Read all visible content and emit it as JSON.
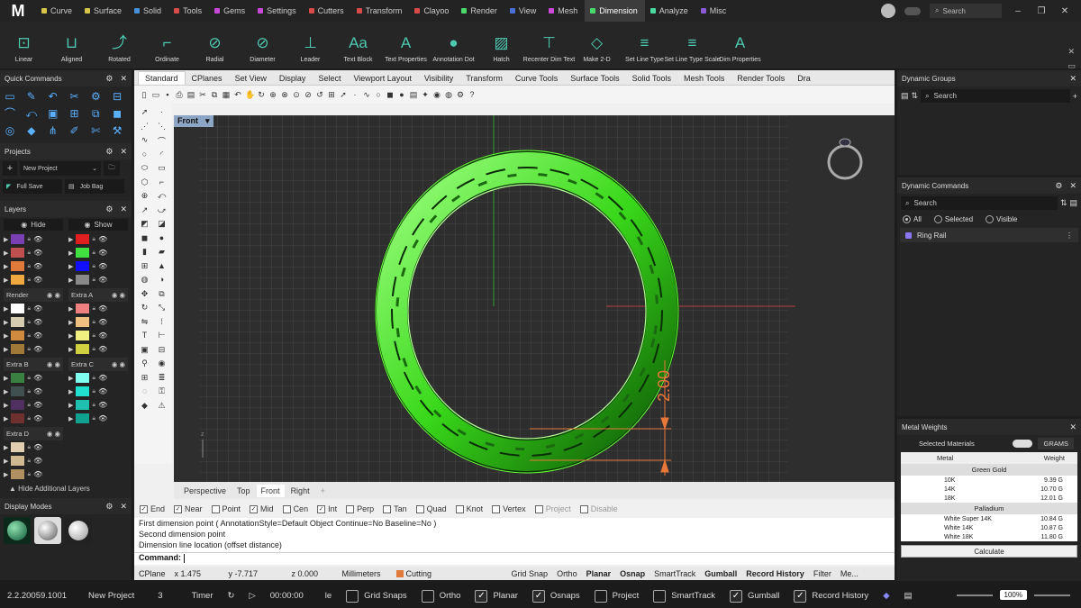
{
  "menubar": {
    "logo": "M",
    "tabs": [
      {
        "label": "Curve",
        "color": "#d9c44a"
      },
      {
        "label": "Surface",
        "color": "#d9c44a"
      },
      {
        "label": "Solid",
        "color": "#4a8fd9"
      },
      {
        "label": "Tools",
        "color": "#d94a4a"
      },
      {
        "label": "Gems",
        "color": "#c94ad9"
      },
      {
        "label": "Settings",
        "color": "#c94ad9"
      },
      {
        "label": "Cutters",
        "color": "#d94a4a"
      },
      {
        "label": "Transform",
        "color": "#d94a4a"
      },
      {
        "label": "Clayoo",
        "color": "#d94a4a"
      },
      {
        "label": "Render",
        "color": "#4ad96b"
      },
      {
        "label": "View",
        "color": "#4a6fd9"
      },
      {
        "label": "Mesh",
        "color": "#c94ad9"
      },
      {
        "label": "Dimension",
        "color": "#4ad96b"
      },
      {
        "label": "Analyze",
        "color": "#4ad9a0"
      },
      {
        "label": "Misc",
        "color": "#8a5ad9"
      }
    ],
    "active_tab": "Dimension",
    "search_placeholder": "Search"
  },
  "toolbar": {
    "tools": [
      {
        "label": "Linear",
        "icon": "⊡"
      },
      {
        "label": "Aligned",
        "icon": "⊔"
      },
      {
        "label": "Rotated",
        "icon": "⤴"
      },
      {
        "label": "Ordinate",
        "icon": "⌐"
      },
      {
        "label": "Radial",
        "icon": "⊘"
      },
      {
        "label": "Diameter",
        "icon": "⊘"
      },
      {
        "label": "Leader",
        "icon": "⊥"
      },
      {
        "label": "Text Block",
        "icon": "Aa"
      },
      {
        "label": "Text Properties",
        "icon": "A"
      },
      {
        "label": "Annotation Dot",
        "icon": "●"
      },
      {
        "label": "Hatch",
        "icon": "▨"
      },
      {
        "label": "Recenter Dim Text",
        "icon": "⊤"
      },
      {
        "label": "Make 2-D",
        "icon": "◇"
      },
      {
        "label": "Set Line Type",
        "icon": "≡"
      },
      {
        "label": "Set Line Type Scale",
        "icon": "≡"
      },
      {
        "label": "Dim Properties",
        "icon": "A"
      }
    ]
  },
  "left": {
    "quick_commands_title": "Quick Commands",
    "projects_title": "Projects",
    "project_name": "New Project",
    "full_save": "Full Save",
    "job_bag": "Job Bag",
    "layers_title": "Layers",
    "hide": "Hide",
    "show": "Show",
    "hide_additional": "Hide Additional Layers",
    "display_modes_title": "Display Modes",
    "groups": [
      {
        "left": {
          "name": "",
          "colors": [
            "#7a3fb0",
            "#c0504d",
            "#e07a3a",
            "#f0a840"
          ]
        },
        "right": {
          "name": "",
          "colors": [
            "#e02020",
            "#40e040",
            "#1010ff",
            "#888888"
          ]
        }
      },
      {
        "left": {
          "name": "Render",
          "colors": [
            "#ffffff",
            "#d6ccb0",
            "#d08a40",
            "#a07838"
          ]
        },
        "right": {
          "name": "Extra A",
          "colors": [
            "#f08080",
            "#f0c080",
            "#f0f080",
            "#d0d040"
          ]
        }
      },
      {
        "left": {
          "name": "Extra B",
          "colors": [
            "#3a8040",
            "#405050",
            "#503060",
            "#703030"
          ]
        },
        "right": {
          "name": "Extra C",
          "colors": [
            "#80fff0",
            "#20e0d0",
            "#20c0b0",
            "#10a090"
          ]
        }
      },
      {
        "left": {
          "name": "Extra D",
          "colors": [
            "#e0d0b0",
            "#d0b890",
            "#b09060"
          ]
        },
        "right": null
      }
    ]
  },
  "center": {
    "tabs": [
      "Standard",
      "CPlanes",
      "Set View",
      "Display",
      "Select",
      "Viewport Layout",
      "Visibility",
      "Transform",
      "Curve Tools",
      "Surface Tools",
      "Solid Tools",
      "Mesh Tools",
      "Render Tools",
      "Dra"
    ],
    "viewport_label": "Front",
    "dimension_text": "2.00",
    "viewport_tabs": [
      "Perspective",
      "Top",
      "Front",
      "Right"
    ],
    "osnaps": [
      {
        "label": "End",
        "checked": true
      },
      {
        "label": "Near",
        "checked": true
      },
      {
        "label": "Point",
        "checked": false
      },
      {
        "label": "Mid",
        "checked": true
      },
      {
        "label": "Cen",
        "checked": false
      },
      {
        "label": "Int",
        "checked": true
      },
      {
        "label": "Perp",
        "checked": false
      },
      {
        "label": "Tan",
        "checked": false
      },
      {
        "label": "Quad",
        "checked": false
      },
      {
        "label": "Knot",
        "checked": false
      },
      {
        "label": "Vertex",
        "checked": false
      },
      {
        "label": "Project",
        "checked": false,
        "dim": true
      },
      {
        "label": "Disable",
        "checked": false,
        "dim": true
      }
    ],
    "history": [
      "First dimension point ( AnnotationStyle=Default  Object  Continue=No  Baseline=No )",
      "Second dimension point",
      "Dimension line location (offset distance)"
    ],
    "command_label": "Command:",
    "status": {
      "cplane": "CPlane",
      "x": "x 1.475",
      "y": "y -7.717",
      "z": "z 0.000",
      "units": "Millimeters",
      "layer": "Cutting",
      "grid_snap": "Grid Snap",
      "ortho": "Ortho",
      "planar": "Planar",
      "osnap": "Osnap",
      "smarttrack": "SmartTrack",
      "gumball": "Gumball",
      "record_history": "Record History",
      "filter": "Filter",
      "memory": "Me..."
    }
  },
  "right": {
    "dynamic_groups_title": "Dynamic Groups",
    "search": "Search",
    "dynamic_commands_title": "Dynamic Commands",
    "radio_all": "All",
    "radio_selected": "Selected",
    "radio_visible": "Visible",
    "command_item": "Ring Rail",
    "metal_weights_title": "Metal Weights",
    "selected_materials": "Selected Materials",
    "unit": "GRAMS",
    "col_metal": "Metal",
    "col_weight": "Weight",
    "groups": [
      {
        "name": "Green Gold",
        "rows": [
          [
            "10K",
            "9.39 G"
          ],
          [
            "14K",
            "10.70 G"
          ],
          [
            "18K",
            "12.01 G"
          ]
        ]
      },
      {
        "name": "Palladium",
        "rows": [
          [
            "White Super 14K",
            "10.84 G"
          ],
          [
            "White 14K",
            "10.87 G"
          ],
          [
            "White 18K",
            "11.80 G"
          ]
        ]
      }
    ],
    "calculate": "Calculate"
  },
  "bottom": {
    "version": "2.2.20059.1001",
    "project": "New Project",
    "count": "3",
    "timer_label": "Timer",
    "time": "00:00:00",
    "le": "le",
    "toggles": [
      {
        "label": "Grid Snaps",
        "checked": false
      },
      {
        "label": "Ortho",
        "checked": false
      },
      {
        "label": "Planar",
        "checked": true
      },
      {
        "label": "Osnaps",
        "checked": true
      },
      {
        "label": "Project",
        "checked": false
      },
      {
        "label": "SmartTrack",
        "checked": false
      },
      {
        "label": "Gumball",
        "checked": true
      },
      {
        "label": "Record History",
        "checked": true
      }
    ],
    "zoom": "100%"
  }
}
